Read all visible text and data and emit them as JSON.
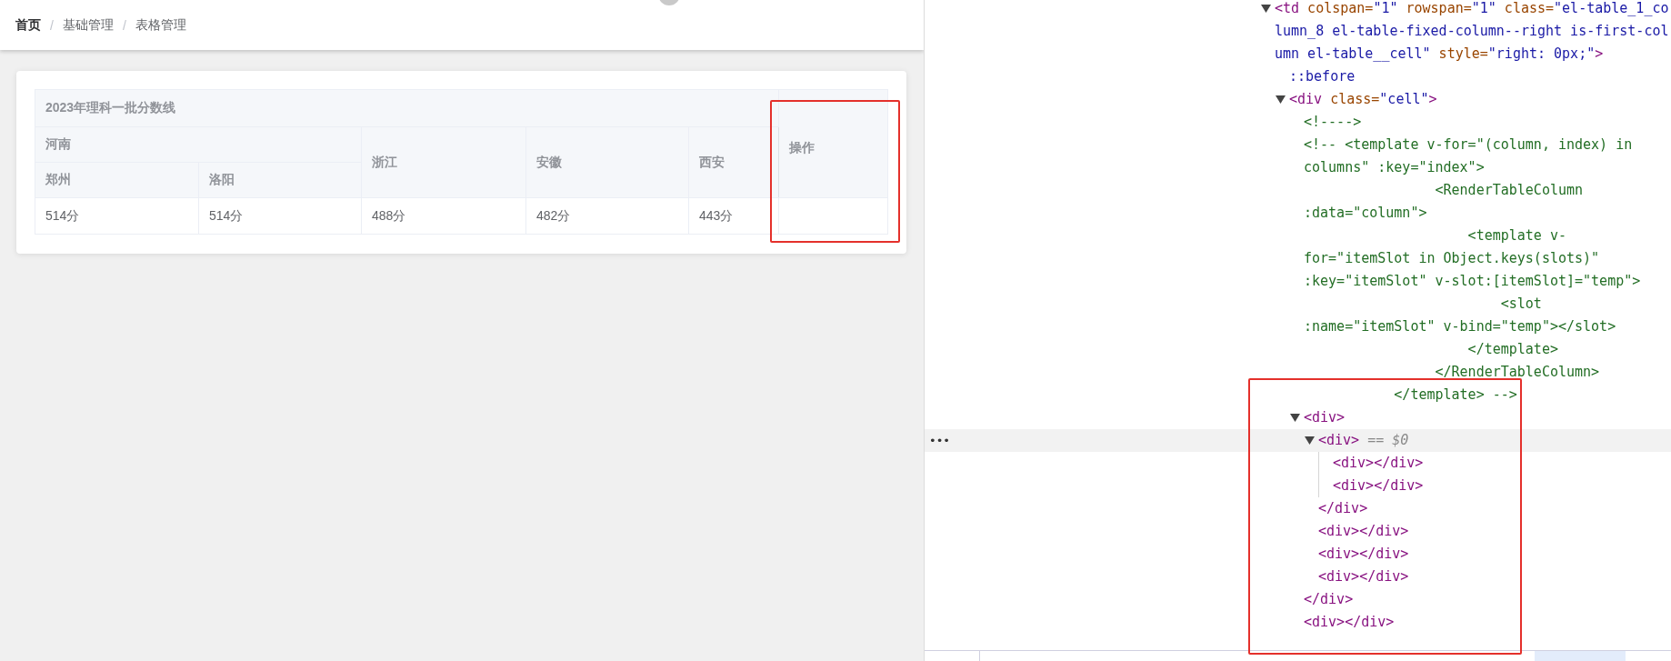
{
  "header": {
    "breadcrumb": {
      "separator": "/",
      "items": [
        {
          "label": "首页",
          "link": true
        },
        {
          "label": "基础管理",
          "link": false
        },
        {
          "label": "表格管理",
          "link": false
        }
      ]
    }
  },
  "table": {
    "header_rows": [
      [
        {
          "label": "2023年理科一批分数线",
          "colspan": 5
        },
        {
          "label": "操作",
          "rowspan": 3
        }
      ],
      [
        {
          "label": "河南",
          "colspan": 2
        },
        {
          "label": "浙江",
          "rowspan": 2
        },
        {
          "label": "安徽",
          "rowspan": 2
        },
        {
          "label": "西安",
          "rowspan": 2
        }
      ],
      [
        {
          "label": "郑州"
        },
        {
          "label": "洛阳"
        }
      ]
    ],
    "rows": [
      {
        "cells": [
          "514分",
          "514分",
          "488分",
          "482分",
          "443分"
        ]
      }
    ]
  },
  "elements_panel": {
    "selected_row_menu": "•••",
    "nodes": [
      {
        "expanded": true,
        "selected": false,
        "lines": [
          [
            {
              "kind": "tag",
              "text": "<td"
            },
            {
              "kind": "attr",
              "text": " colspan="
            },
            {
              "kind": "value",
              "text": "\"1\""
            },
            {
              "kind": "attr",
              "text": " rowspan="
            },
            {
              "kind": "value",
              "text": "\"1\""
            },
            {
              "kind": "attr",
              "text": " class="
            },
            {
              "kind": "value",
              "text": "\"el-table_1_co"
            }
          ],
          [
            {
              "kind": "value",
              "text": "lumn_8 el-table-fixed-column--right is-first-col"
            }
          ],
          [
            {
              "kind": "value",
              "text": "umn el-table__cell\""
            },
            {
              "kind": "attr",
              "text": " style="
            },
            {
              "kind": "value",
              "text": "\"right: 0px;\""
            },
            {
              "kind": "tag",
              "text": ">"
            }
          ]
        ],
        "children": [
          {
            "selected": false,
            "lines": [
              [
                {
                  "kind": "pseudo",
                  "text": "::before"
                }
              ]
            ]
          },
          {
            "expanded": true,
            "selected": false,
            "lines": [
              [
                {
                  "kind": "tag",
                  "text": "<div"
                },
                {
                  "kind": "attr",
                  "text": " class="
                },
                {
                  "kind": "value",
                  "text": "\"cell\""
                },
                {
                  "kind": "tag",
                  "text": ">"
                }
              ]
            ],
            "children": [
              {
                "selected": false,
                "lines": [
                  [
                    {
                      "kind": "comment",
                      "text": "<!---->"
                    }
                  ]
                ]
              },
              {
                "selected": false,
                "lines": [
                  [
                    {
                      "kind": "comment",
                      "text": "<!-- <template v-for=\"(column, index) in"
                    }
                  ],
                  [
                    {
                      "kind": "comment",
                      "text": "columns\" :key=\"index\">"
                    }
                  ],
                  [
                    {
                      "kind": "comment",
                      "text": "                <RenderTableColumn"
                    }
                  ],
                  [
                    {
                      "kind": "comment",
                      "text": ":data=\"column\">"
                    }
                  ],
                  [
                    {
                      "kind": "comment",
                      "text": "                    <template v-"
                    }
                  ],
                  [
                    {
                      "kind": "comment",
                      "text": "for=\"itemSlot in Object.keys(slots)\""
                    }
                  ],
                  [
                    {
                      "kind": "comment",
                      "text": ":key=\"itemSlot\" v-slot:[itemSlot]=\"temp\">"
                    }
                  ],
                  [
                    {
                      "kind": "comment",
                      "text": "                        <slot"
                    }
                  ],
                  [
                    {
                      "kind": "comment",
                      "text": ":name=\"itemSlot\" v-bind=\"temp\"></slot>"
                    }
                  ],
                  [
                    {
                      "kind": "comment",
                      "text": "                    </template>"
                    }
                  ],
                  [
                    {
                      "kind": "comment",
                      "text": "                </RenderTableColumn>"
                    }
                  ],
                  [
                    {
                      "kind": "comment",
                      "text": "           </template> -->"
                    }
                  ]
                ]
              },
              {
                "expanded": true,
                "selected": false,
                "lines": [
                  [
                    {
                      "kind": "tag",
                      "text": "<div>"
                    }
                  ]
                ],
                "children": [
                  {
                    "expanded": true,
                    "selected": true,
                    "lines": [
                      [
                        {
                          "kind": "tag",
                          "text": "<div>"
                        },
                        {
                          "kind": "marker",
                          "text": " == $0"
                        }
                      ]
                    ],
                    "children": [
                      {
                        "selected": false,
                        "lines": [
                          [
                            {
                              "kind": "tag",
                              "text": "<div></div>"
                            }
                          ]
                        ]
                      },
                      {
                        "selected": false,
                        "lines": [
                          [
                            {
                              "kind": "tag",
                              "text": "<div></div>"
                            }
                          ]
                        ]
                      }
                    ],
                    "closing": [
                      {
                        "kind": "tag",
                        "text": "</div>"
                      }
                    ]
                  },
                  {
                    "selected": false,
                    "lines": [
                      [
                        {
                          "kind": "tag",
                          "text": "<div></div>"
                        }
                      ]
                    ]
                  },
                  {
                    "selected": false,
                    "lines": [
                      [
                        {
                          "kind": "tag",
                          "text": "<div></div>"
                        }
                      ]
                    ]
                  },
                  {
                    "selected": false,
                    "lines": [
                      [
                        {
                          "kind": "tag",
                          "text": "<div></div>"
                        }
                      ]
                    ]
                  }
                ],
                "closing": [
                  {
                    "kind": "tag",
                    "text": "</div>"
                  }
                ]
              },
              {
                "selected": false,
                "lines": [
                  [
                    {
                      "kind": "tag",
                      "text": "<div></div>"
                    }
                  ]
                ]
              }
            ]
          }
        ]
      }
    ]
  }
}
